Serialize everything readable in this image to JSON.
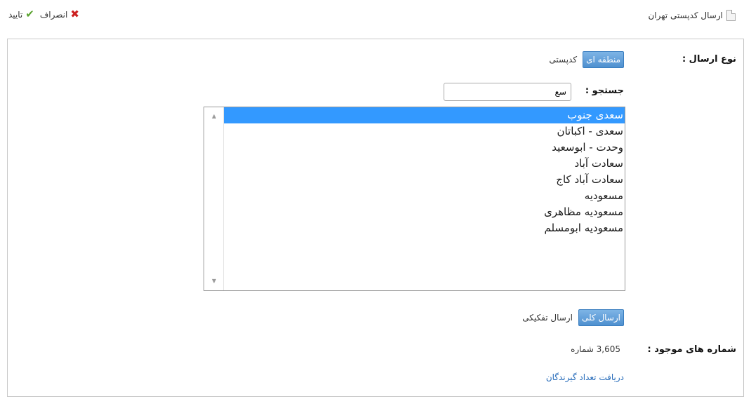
{
  "header": {
    "title": "ارسال کدپستی تهران",
    "cancel_label": "انصراف",
    "confirm_label": "تایید"
  },
  "form": {
    "send_type": {
      "label": "نوع ارسال :",
      "options": [
        "منطقه ای",
        "کدپستی"
      ],
      "selected": "منطقه ای"
    },
    "search": {
      "label": "جستجو :",
      "value": "سع"
    },
    "regions": {
      "items": [
        "سعدی جنوب",
        "سعدی - اکباتان",
        "وحدت - ابوسعید",
        "سعادت آباد",
        "سعادت آباد کاج",
        "مسعودیه",
        "مسعودیه مظاهری",
        "مسعودیه ابومسلم"
      ],
      "selected": "سعدی جنوب"
    },
    "send_mode": {
      "options": [
        "ارسال کلی",
        "ارسال تفکیکی"
      ],
      "selected": "ارسال کلی"
    },
    "available": {
      "label": "شماره های موجود :",
      "value": "3,605 شماره"
    },
    "recipients_link": "دریافت تعداد گیرندگان"
  },
  "colors": {
    "accent": "#5b9bd5",
    "selection": "#3399ff",
    "link": "#2a6ebb",
    "cancel": "#cc1f1f",
    "confirm": "#5aa32f"
  }
}
